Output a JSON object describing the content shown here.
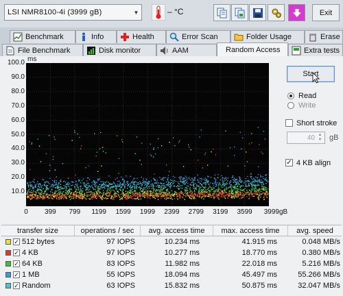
{
  "toolbar": {
    "drive": "LSI    NMR8100-4i          (3999 gB)",
    "temperature": "– °C",
    "exit_label": "Exit"
  },
  "tabs_row1": [
    {
      "label": "Benchmark",
      "icon": "benchmark-icon"
    },
    {
      "label": "Info",
      "icon": "info-icon"
    },
    {
      "label": "Health",
      "icon": "health-cross-icon"
    },
    {
      "label": "Error Scan",
      "icon": "magnifier-icon"
    },
    {
      "label": "Folder Usage",
      "icon": "folder-icon"
    },
    {
      "label": "Erase",
      "icon": "trash-icon"
    }
  ],
  "tabs_row2": [
    {
      "label": "File Benchmark",
      "icon": "file-icon"
    },
    {
      "label": "Disk monitor",
      "icon": "monitor-icon"
    },
    {
      "label": "AAM",
      "icon": "speaker-icon"
    },
    {
      "label": "Random Access",
      "icon": "",
      "active": true
    },
    {
      "label": "Extra tests",
      "icon": "extra-icon"
    }
  ],
  "controls": {
    "start_label": "Start",
    "read_label": "Read",
    "write_label": "Write",
    "short_stroke_label": "Short stroke",
    "stroke_value": "40",
    "stroke_unit": "gB",
    "align_label": "4 KB align",
    "mode_selected": "Read",
    "short_stroke_checked": false,
    "align_checked": true
  },
  "chart_data": {
    "type": "scatter",
    "ylabel": "ms",
    "xlabel": "gB",
    "ylim": [
      0,
      100
    ],
    "xlim": [
      0,
      3999
    ],
    "yticks": [
      "100.0",
      "90.0",
      "80.0",
      "70.0",
      "60.0",
      "50.0",
      "40.0",
      "30.0",
      "20.0",
      "10.0"
    ],
    "xticks": [
      "0",
      "399",
      "799",
      "1199",
      "1599",
      "1999",
      "2399",
      "2799",
      "3199",
      "3599",
      "3999gB"
    ],
    "grid": true,
    "series": [
      {
        "name": "512 bytes",
        "color": "#e8e23a",
        "y_center": 10.2,
        "y_spread": 9,
        "trend": 1.5
      },
      {
        "name": "4 KB",
        "color": "#e03a2e",
        "y_center": 10.3,
        "y_spread": 6,
        "trend": 1.5
      },
      {
        "name": "64 KB",
        "color": "#3fbf3a",
        "y_center": 12.0,
        "y_spread": 8,
        "trend": 2.5
      },
      {
        "name": "1 MB",
        "color": "#2f9fe0",
        "y_center": 18.1,
        "y_spread": 10,
        "trend": 4.0
      },
      {
        "name": "Random",
        "color": "#49c7c7",
        "y_center": 15.8,
        "y_spread": 9,
        "trend": 3.0
      }
    ]
  },
  "table": {
    "headers": [
      "transfer size",
      "operations / sec",
      "avg. access time",
      "max. access time",
      "avg. speed"
    ],
    "rows": [
      {
        "label": "512 bytes",
        "color": "#e8e23a",
        "checked": true,
        "ops": "97 IOPS",
        "avg": "10.234 ms",
        "max": "41.915 ms",
        "speed": "0.048 MB/s"
      },
      {
        "label": "4 KB",
        "color": "#e03a2e",
        "checked": true,
        "ops": "97 IOPS",
        "avg": "10.277 ms",
        "max": "18.770 ms",
        "speed": "0.380 MB/s"
      },
      {
        "label": "64 KB",
        "color": "#3fbf3a",
        "checked": true,
        "ops": "83 IOPS",
        "avg": "11.982 ms",
        "max": "22.018 ms",
        "speed": "5.216 MB/s"
      },
      {
        "label": "1 MB",
        "color": "#2f9fe0",
        "checked": true,
        "ops": "55 IOPS",
        "avg": "18.094 ms",
        "max": "45.497 ms",
        "speed": "55.266 MB/s"
      },
      {
        "label": "Random",
        "color": "#49c7c7",
        "checked": true,
        "ops": "63 IOPS",
        "avg": "15.832 ms",
        "max": "50.875 ms",
        "speed": "32.047 MB/s"
      }
    ]
  }
}
